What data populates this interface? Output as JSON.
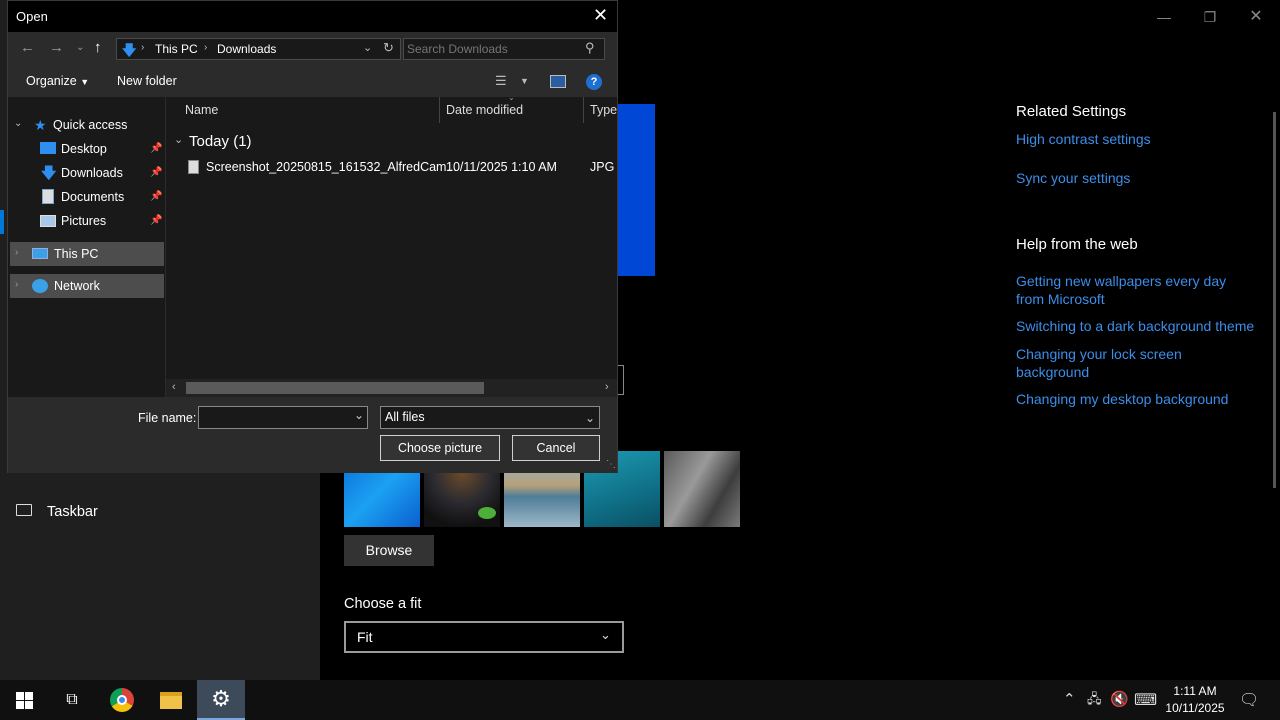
{
  "settings": {
    "related_title": "Related Settings",
    "related_links": [
      "High contrast settings",
      "Sync your settings"
    ],
    "help_title": "Help from the web",
    "help_links": [
      "Getting new wallpapers every day from Microsoft",
      "Switching to a dark background theme",
      "Changing your lock screen background",
      "Changing my desktop background"
    ],
    "browse_label": "Browse",
    "choose_fit_label": "Choose a fit",
    "fit_value": "Fit",
    "taskbar_nav_label": "Taskbar",
    "accent_color": "#0047d6",
    "link_color": "#3b8eea"
  },
  "dialog": {
    "title": "Open",
    "breadcrumb": [
      "This PC",
      "Downloads"
    ],
    "search_placeholder": "Search Downloads",
    "organize_label": "Organize",
    "new_folder_label": "New folder",
    "nav": {
      "quick_access": "Quick access",
      "items": [
        "Desktop",
        "Downloads",
        "Documents",
        "Pictures"
      ],
      "this_pc": "This PC",
      "network": "Network"
    },
    "columns": {
      "name": "Name",
      "date": "Date modified",
      "type": "Type"
    },
    "group_label": "Today (1)",
    "files": [
      {
        "name": "Screenshot_20250815_161532_AlfredCam...",
        "date": "10/11/2025 1:10 AM",
        "type": "JPG F"
      }
    ],
    "file_name_label": "File name:",
    "file_name_value": "",
    "filter_value": "All files",
    "choose_button": "Choose picture",
    "cancel_button": "Cancel"
  },
  "taskbar": {
    "time": "1:11 AM",
    "date": "10/11/2025"
  }
}
